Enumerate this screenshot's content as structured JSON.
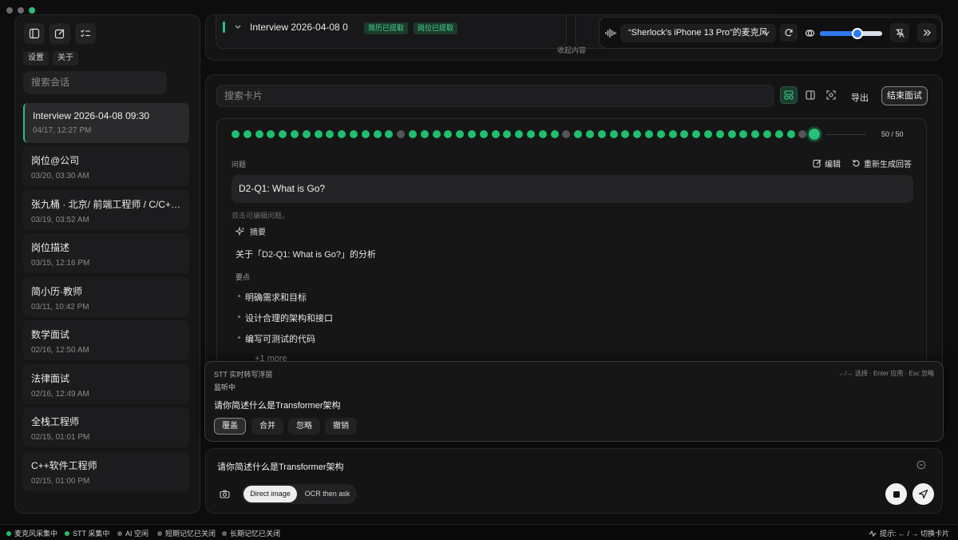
{
  "sidebar": {
    "settings_label": "设置",
    "about_label": "关于",
    "search_placeholder": "搜索会话",
    "sessions": [
      {
        "title": "Interview 2026-04-08 09:30",
        "date": "04/17, 12:27 PM"
      },
      {
        "title": "岗位@公司",
        "date": "03/20, 03:30 AM"
      },
      {
        "title": "张九桶 · 北京/ 前端工程师 / C/C++工…",
        "date": "03/19, 03:52 AM"
      },
      {
        "title": "岗位描述",
        "date": "03/15, 12:16 PM"
      },
      {
        "title": "简小历·教师",
        "date": "03/11, 10:42 PM"
      },
      {
        "title": "数学面试",
        "date": "02/16, 12:50 AM"
      },
      {
        "title": "法律面试",
        "date": "02/16, 12:49 AM"
      },
      {
        "title": "全栈工程师",
        "date": "02/15, 01:01 PM"
      },
      {
        "title": "C++软件工程师",
        "date": "02/15, 01:00 PM"
      }
    ]
  },
  "top": {
    "session_title": "Interview 2026-04-08 0",
    "badge_resume": "简历已提取",
    "badge_job": "岗位已提取",
    "collapse_label": "收起内容"
  },
  "mic": {
    "device": "“Sherlock’s iPhone 13 Pro”的麦克风",
    "volume": 0.6
  },
  "cards": {
    "search_placeholder": "搜索卡片",
    "export_label": "导出",
    "end_label": "结束面试",
    "progress_current": 50,
    "progress_total": 50,
    "progress_text": "50 / 50",
    "question_label": "问题",
    "edit_label": "编辑",
    "regenerate_label": "重新生成回答",
    "question": "D2-Q1: What is Go?",
    "hint": "双击可编辑问题。",
    "summary_label": "摘要",
    "summary_text": "关于「D2-Q1: What is Go?」的分析",
    "keypoints_label": "要点",
    "points": [
      "明确需求和目标",
      "设计合理的架构和接口",
      "编写可测试的代码"
    ],
    "more_label": "+1 more"
  },
  "stt": {
    "title": "STT 实时转写浮层",
    "shortcuts": "←/→ 选择 · Enter 应用 · Esc 忽略",
    "status": "监听中",
    "text": "请你简述什么是Transformer架构",
    "actions": [
      "覆盖",
      "合并",
      "忽略",
      "撤销"
    ]
  },
  "input": {
    "value": "请你简述什么是Transformer架构",
    "mode_direct": "Direct image",
    "mode_ocr": "OCR then ask"
  },
  "status": {
    "items": [
      {
        "label": "麦克风采集中",
        "color": "#1fbf6f"
      },
      {
        "label": "STT 采集中",
        "color": "#1fbf6f"
      },
      {
        "label": "AI 空闲",
        "color": "#666666"
      },
      {
        "label": "短期记忆已关闭",
        "color": "#666666"
      },
      {
        "label": "长期记忆已关闭",
        "color": "#666666"
      }
    ],
    "hint": "提示: ← / → 切换卡片"
  },
  "colors": {
    "accent": "#1fbf6f",
    "background": "#0d0d0e",
    "slider": "#2f7af0"
  }
}
